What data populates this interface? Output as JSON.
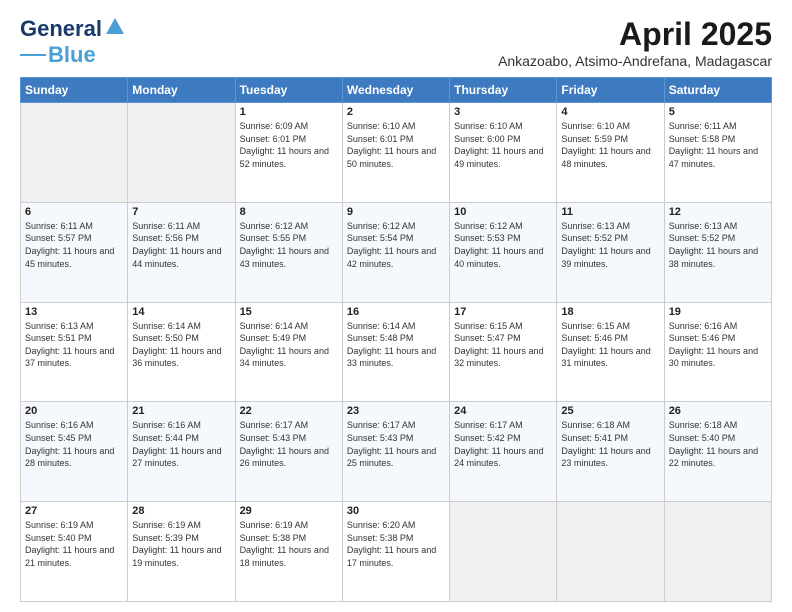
{
  "logo": {
    "line1": "General",
    "line2": "Blue"
  },
  "title": "April 2025",
  "subtitle": "Ankazoabo, Atsimo-Andrefana, Madagascar",
  "days_of_week": [
    "Sunday",
    "Monday",
    "Tuesday",
    "Wednesday",
    "Thursday",
    "Friday",
    "Saturday"
  ],
  "weeks": [
    [
      {
        "day": "",
        "info": ""
      },
      {
        "day": "",
        "info": ""
      },
      {
        "day": "1",
        "info": "Sunrise: 6:09 AM\nSunset: 6:01 PM\nDaylight: 11 hours and 52 minutes."
      },
      {
        "day": "2",
        "info": "Sunrise: 6:10 AM\nSunset: 6:01 PM\nDaylight: 11 hours and 50 minutes."
      },
      {
        "day": "3",
        "info": "Sunrise: 6:10 AM\nSunset: 6:00 PM\nDaylight: 11 hours and 49 minutes."
      },
      {
        "day": "4",
        "info": "Sunrise: 6:10 AM\nSunset: 5:59 PM\nDaylight: 11 hours and 48 minutes."
      },
      {
        "day": "5",
        "info": "Sunrise: 6:11 AM\nSunset: 5:58 PM\nDaylight: 11 hours and 47 minutes."
      }
    ],
    [
      {
        "day": "6",
        "info": "Sunrise: 6:11 AM\nSunset: 5:57 PM\nDaylight: 11 hours and 45 minutes."
      },
      {
        "day": "7",
        "info": "Sunrise: 6:11 AM\nSunset: 5:56 PM\nDaylight: 11 hours and 44 minutes."
      },
      {
        "day": "8",
        "info": "Sunrise: 6:12 AM\nSunset: 5:55 PM\nDaylight: 11 hours and 43 minutes."
      },
      {
        "day": "9",
        "info": "Sunrise: 6:12 AM\nSunset: 5:54 PM\nDaylight: 11 hours and 42 minutes."
      },
      {
        "day": "10",
        "info": "Sunrise: 6:12 AM\nSunset: 5:53 PM\nDaylight: 11 hours and 40 minutes."
      },
      {
        "day": "11",
        "info": "Sunrise: 6:13 AM\nSunset: 5:52 PM\nDaylight: 11 hours and 39 minutes."
      },
      {
        "day": "12",
        "info": "Sunrise: 6:13 AM\nSunset: 5:52 PM\nDaylight: 11 hours and 38 minutes."
      }
    ],
    [
      {
        "day": "13",
        "info": "Sunrise: 6:13 AM\nSunset: 5:51 PM\nDaylight: 11 hours and 37 minutes."
      },
      {
        "day": "14",
        "info": "Sunrise: 6:14 AM\nSunset: 5:50 PM\nDaylight: 11 hours and 36 minutes."
      },
      {
        "day": "15",
        "info": "Sunrise: 6:14 AM\nSunset: 5:49 PM\nDaylight: 11 hours and 34 minutes."
      },
      {
        "day": "16",
        "info": "Sunrise: 6:14 AM\nSunset: 5:48 PM\nDaylight: 11 hours and 33 minutes."
      },
      {
        "day": "17",
        "info": "Sunrise: 6:15 AM\nSunset: 5:47 PM\nDaylight: 11 hours and 32 minutes."
      },
      {
        "day": "18",
        "info": "Sunrise: 6:15 AM\nSunset: 5:46 PM\nDaylight: 11 hours and 31 minutes."
      },
      {
        "day": "19",
        "info": "Sunrise: 6:16 AM\nSunset: 5:46 PM\nDaylight: 11 hours and 30 minutes."
      }
    ],
    [
      {
        "day": "20",
        "info": "Sunrise: 6:16 AM\nSunset: 5:45 PM\nDaylight: 11 hours and 28 minutes."
      },
      {
        "day": "21",
        "info": "Sunrise: 6:16 AM\nSunset: 5:44 PM\nDaylight: 11 hours and 27 minutes."
      },
      {
        "day": "22",
        "info": "Sunrise: 6:17 AM\nSunset: 5:43 PM\nDaylight: 11 hours and 26 minutes."
      },
      {
        "day": "23",
        "info": "Sunrise: 6:17 AM\nSunset: 5:43 PM\nDaylight: 11 hours and 25 minutes."
      },
      {
        "day": "24",
        "info": "Sunrise: 6:17 AM\nSunset: 5:42 PM\nDaylight: 11 hours and 24 minutes."
      },
      {
        "day": "25",
        "info": "Sunrise: 6:18 AM\nSunset: 5:41 PM\nDaylight: 11 hours and 23 minutes."
      },
      {
        "day": "26",
        "info": "Sunrise: 6:18 AM\nSunset: 5:40 PM\nDaylight: 11 hours and 22 minutes."
      }
    ],
    [
      {
        "day": "27",
        "info": "Sunrise: 6:19 AM\nSunset: 5:40 PM\nDaylight: 11 hours and 21 minutes."
      },
      {
        "day": "28",
        "info": "Sunrise: 6:19 AM\nSunset: 5:39 PM\nDaylight: 11 hours and 19 minutes."
      },
      {
        "day": "29",
        "info": "Sunrise: 6:19 AM\nSunset: 5:38 PM\nDaylight: 11 hours and 18 minutes."
      },
      {
        "day": "30",
        "info": "Sunrise: 6:20 AM\nSunset: 5:38 PM\nDaylight: 11 hours and 17 minutes."
      },
      {
        "day": "",
        "info": ""
      },
      {
        "day": "",
        "info": ""
      },
      {
        "day": "",
        "info": ""
      }
    ]
  ]
}
